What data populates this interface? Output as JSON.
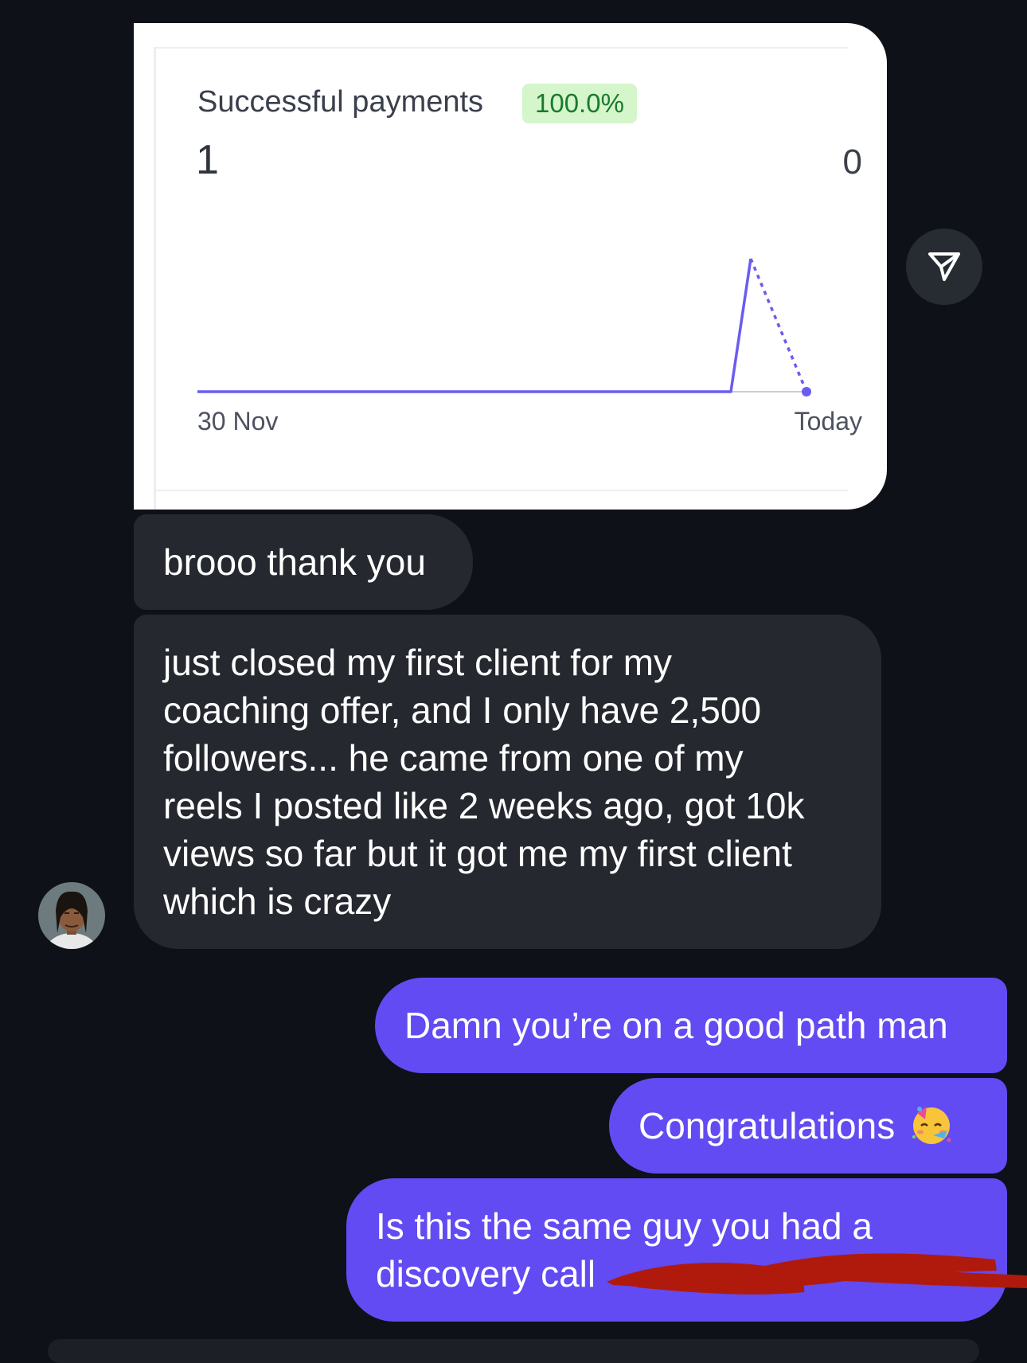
{
  "payment_card": {
    "title": "Successful payments",
    "badge": "100.0%",
    "current_value": "1",
    "previous_value": "0",
    "x_start_label": "30 Nov",
    "x_end_label": "Today"
  },
  "chart_data": {
    "type": "line",
    "title": "Successful payments",
    "x": [
      "30 Nov",
      "Today"
    ],
    "series": [
      {
        "values": [
          0,
          0,
          0,
          1
        ]
      },
      {
        "values": [
          0,
          0,
          0,
          0
        ]
      }
    ],
    "ylim": [
      0,
      1
    ]
  },
  "messages": [
    {
      "id": "m1",
      "side": "incoming",
      "lines": [
        "brooo thank you"
      ]
    },
    {
      "id": "m2",
      "side": "incoming",
      "lines": [
        "just closed my first client for my",
        "coaching offer, and I only have 2,500",
        "followers... he came from one of my",
        "reels I posted like 2 weeks ago, got 10k",
        "views so far but it got me my first client",
        "which is crazy"
      ]
    },
    {
      "id": "m3",
      "side": "outgoing",
      "lines": [
        "Damn you’re on a good path man"
      ]
    },
    {
      "id": "m4",
      "side": "outgoing",
      "lines": [
        "Congratulations"
      ],
      "emoji": "partying-face"
    },
    {
      "id": "m5",
      "side": "outgoing",
      "lines": [
        "Is this the same guy you had a",
        "discovery call"
      ],
      "redacted": true
    }
  ],
  "icons": {
    "share": "paper-plane-icon",
    "emoji": "partying-face-emoji"
  },
  "colors": {
    "background": "#0e1117",
    "incoming_bubble": "#25282e",
    "outgoing_bubble": "#624bf2",
    "chart_line": "#6a5cf0",
    "badge_bg": "#d5f5cb",
    "redaction": "#b01a0c"
  }
}
